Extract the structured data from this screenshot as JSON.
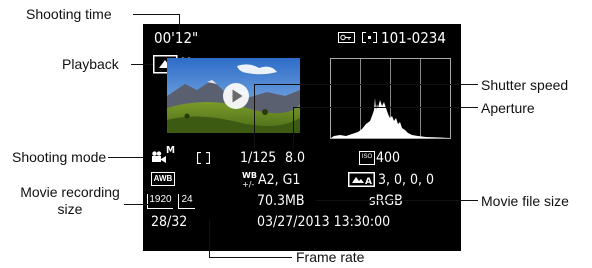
{
  "callouts": {
    "shooting_time": "Shooting time",
    "playback": "Playback",
    "shutter_speed": "Shutter speed",
    "aperture": "Aperture",
    "shooting_mode": "Shooting mode",
    "movie_recording_size_line1": "Movie recording",
    "movie_recording_size_line2": "size",
    "movie_file_size": "Movie file size",
    "frame_rate": "Frame rate"
  },
  "screen": {
    "shooting_time": "00'12\"",
    "protect_icon": "key-icon",
    "folder_file": "101-0234",
    "playback_icon": "play-movie-icon",
    "mode_text": "M",
    "shutter": "1/125",
    "aperture": "8.0",
    "iso_label": "ISO",
    "iso_value": "400",
    "wb": "AWB",
    "wb_shift": "A2, G1",
    "picture_style": "3,  0,  0,  0",
    "recording_size": "1920",
    "frame_rate": "24",
    "file_size": "70.3MB",
    "color_space": "sRGB",
    "counter": "28/32",
    "datetime": "03/27/2013  13:30:00"
  }
}
